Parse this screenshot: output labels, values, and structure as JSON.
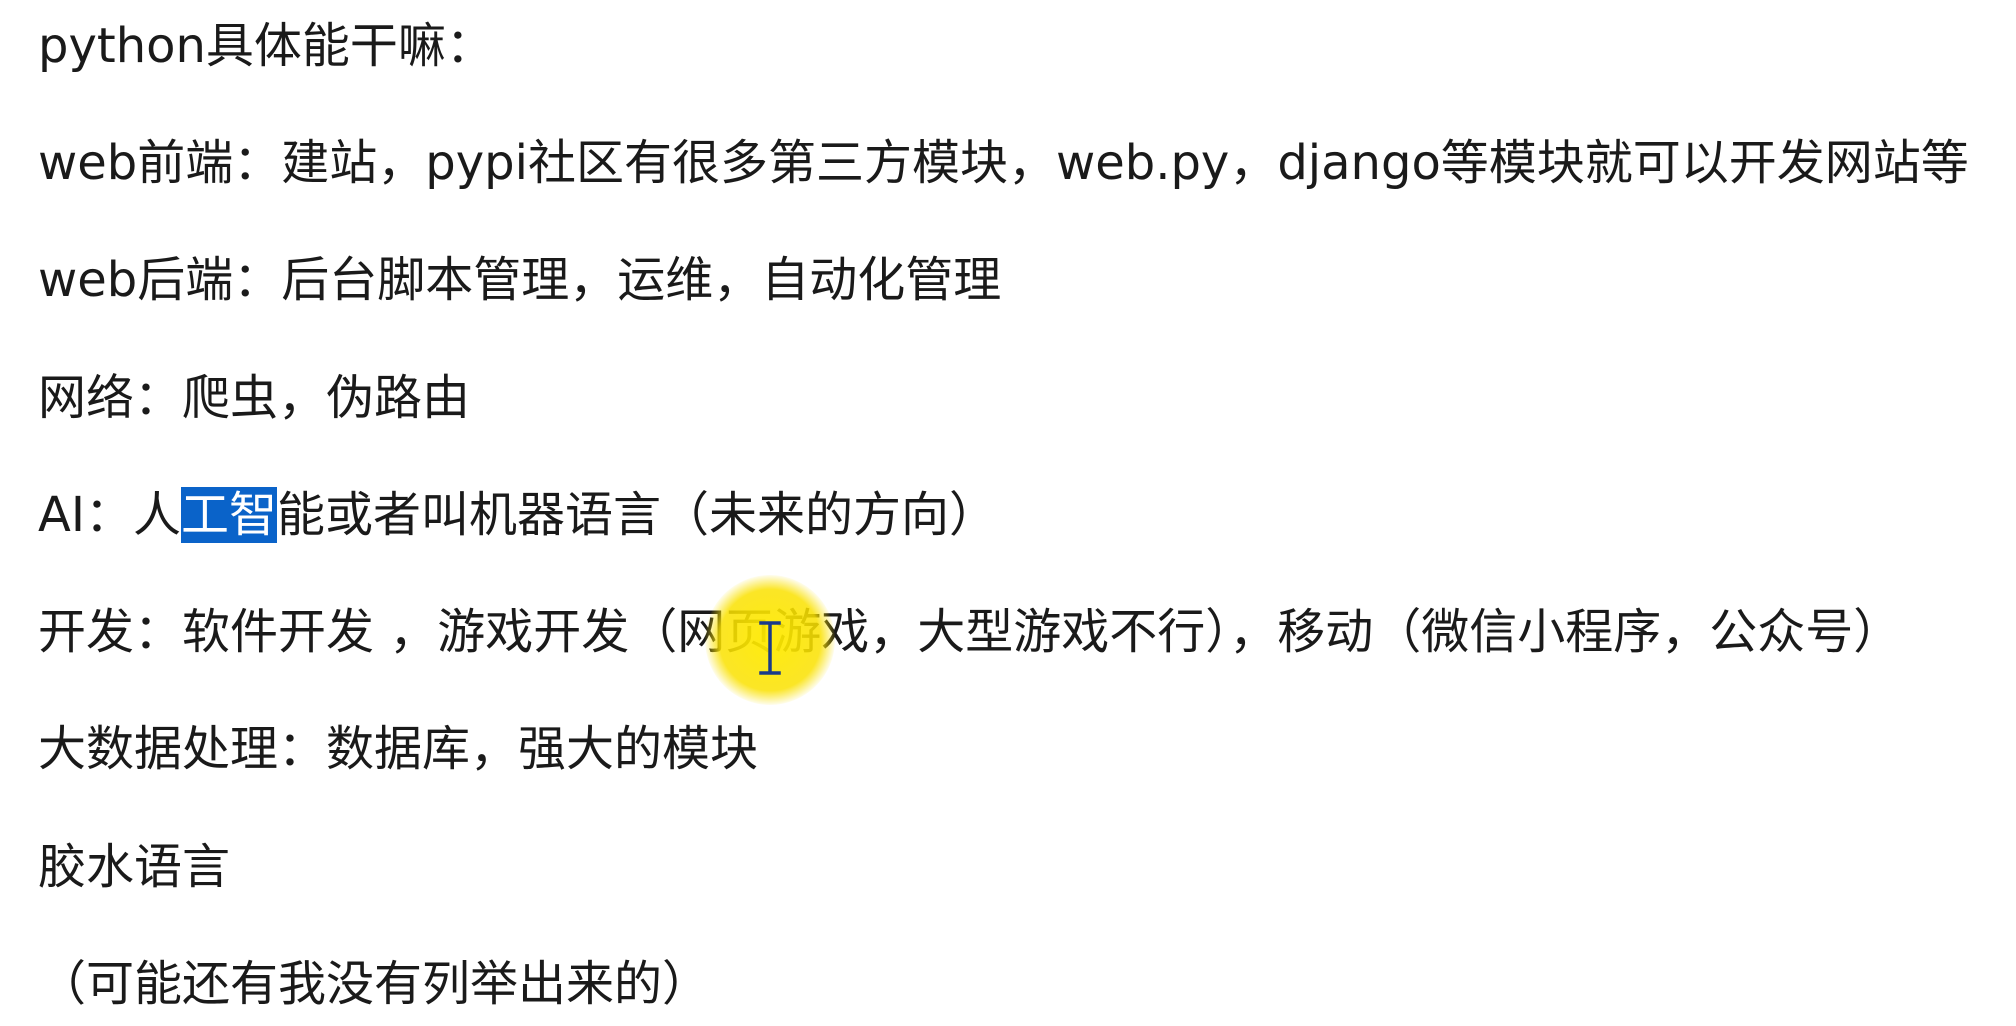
{
  "document": {
    "lines": [
      "python具体能干嘛：",
      "web前端：建站，pypi社区有很多第三方模块，web.py，django等模块就可以开发网站等",
      "web后端：后台脚本管理，运维，自动化管理",
      "网络：爬虫，伪路由",
      "开发：软件开发 ，游戏开发（网页游戏，大型游戏不行），移动（微信小程序，公众号）",
      "大数据处理：数据库，强大的模块",
      "胶水语言",
      "（可能还有我没有列举出来的）"
    ],
    "ai_line": {
      "before": "AI：人",
      "selected": "工智",
      "after": "能或者叫机器语言（未来的方向）"
    }
  },
  "colors": {
    "text": "#1a1a1a",
    "selection": "#0a63c9",
    "cursor_highlight": "#f5e000"
  },
  "icons": {
    "cursor": "text-cursor-icon"
  }
}
